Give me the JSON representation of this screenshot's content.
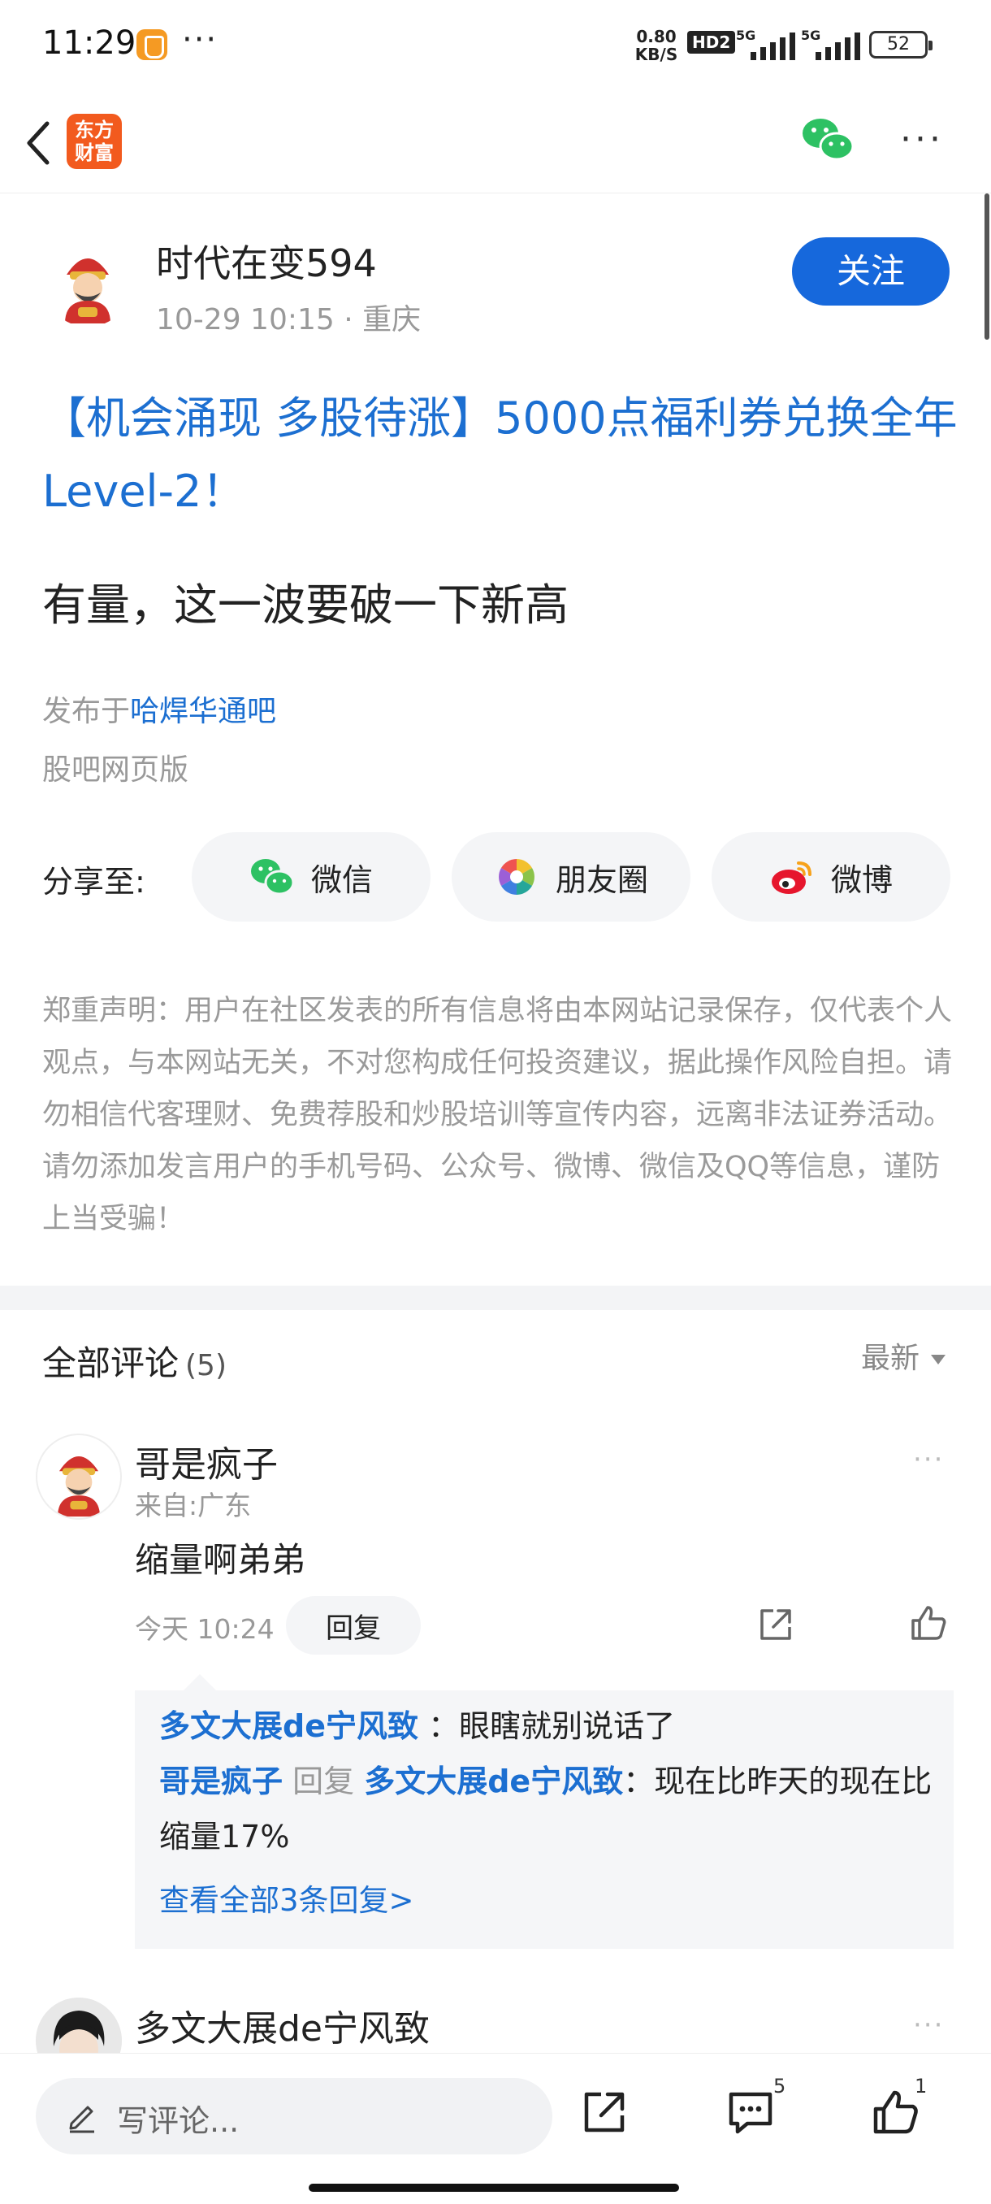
{
  "status_bar": {
    "time": "11:29",
    "dots": "···",
    "speed_value": "0.80",
    "speed_unit": "KB/S",
    "hd": "HD2",
    "net1": "5G",
    "net2": "5G",
    "battery": "52"
  },
  "nav": {
    "logo_line1": "东方",
    "logo_line2": "财富"
  },
  "author": {
    "name": "时代在变594",
    "meta": "10-29 10:15 · 重庆",
    "follow_label": "关注"
  },
  "article": {
    "title": "【机会涌现 多股待涨】5000点福利券兑换全年Level-2！",
    "body": "有量，这一波要破一下新高",
    "published_prefix": "发布于",
    "published_bar": "哈焊华通吧",
    "source": "股吧网页版"
  },
  "share": {
    "label": "分享至:",
    "buttons": [
      {
        "label": "微信",
        "icon": "wechat-icon"
      },
      {
        "label": "朋友圈",
        "icon": "moments-icon"
      },
      {
        "label": "微博",
        "icon": "weibo-icon"
      }
    ]
  },
  "disclaimer": "郑重声明：用户在社区发表的所有信息将由本网站记录保存，仅代表个人观点，与本网站无关，不对您构成任何投资建议，据此操作风险自担。请勿相信代客理财、免费荐股和炒股培训等宣传内容，远离非法证券活动。请勿添加发言用户的手机号码、公众号、微博、微信及QQ等信息，谨防上当受骗！",
  "comments_header": {
    "title": "全部评论",
    "count": "(5)",
    "sort": "最新"
  },
  "comment1": {
    "name": "哥是疯子",
    "location": "来自:广东",
    "text": "缩量啊弟弟",
    "time": "今天 10:24",
    "reply_label": "回复",
    "replies": [
      {
        "user": "多文大展de宁风致",
        "text": "：眼瞎就别说话了"
      },
      {
        "user": "哥是疯子",
        "reply_word": "回复",
        "target": "多文大展de宁风致",
        "text": "：现在比昨天的现在比缩量17%"
      }
    ],
    "view_all": "查看全部3条回复>"
  },
  "comment2": {
    "name": "多文大展de宁风致"
  },
  "bottom_bar": {
    "placeholder": "写评论...",
    "comment_count": "5",
    "like_count": "1"
  },
  "colors": {
    "accent_blue": "#1c6fd1",
    "follow_button": "#1668dc",
    "brand_orange": "#f25a1e"
  }
}
